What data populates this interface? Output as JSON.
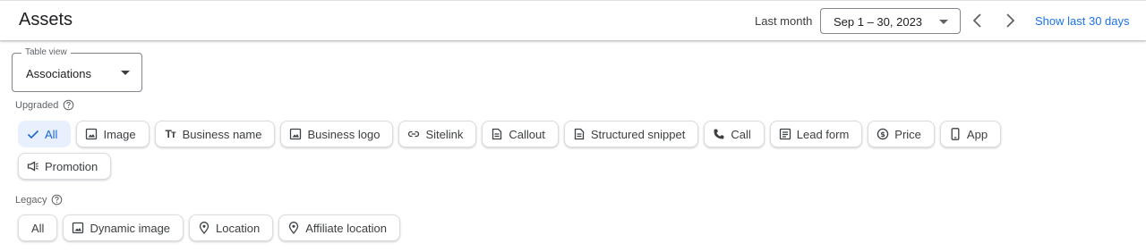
{
  "header": {
    "title": "Assets",
    "range_label": "Last month",
    "date_range": "Sep 1 – 30, 2023",
    "show_last": "Show last 30 days"
  },
  "table_view": {
    "legend": "Table view",
    "value": "Associations"
  },
  "upgraded": {
    "label": "Upgraded",
    "chips": [
      {
        "label": "All",
        "icon": "check-icon",
        "selected": true
      },
      {
        "label": "Image",
        "icon": "image-icon"
      },
      {
        "label": "Business name",
        "icon": "text-icon"
      },
      {
        "label": "Business logo",
        "icon": "image-icon"
      },
      {
        "label": "Sitelink",
        "icon": "link-icon"
      },
      {
        "label": "Callout",
        "icon": "document-icon"
      },
      {
        "label": "Structured snippet",
        "icon": "document-icon"
      },
      {
        "label": "Call",
        "icon": "phone-icon"
      },
      {
        "label": "Lead form",
        "icon": "form-icon"
      },
      {
        "label": "Price",
        "icon": "price-icon"
      },
      {
        "label": "App",
        "icon": "mobile-icon"
      },
      {
        "label": "Promotion",
        "icon": "megaphone-icon"
      }
    ]
  },
  "legacy": {
    "label": "Legacy",
    "chips": [
      {
        "label": "All"
      },
      {
        "label": "Dynamic image",
        "icon": "image-icon"
      },
      {
        "label": "Location",
        "icon": "pin-icon"
      },
      {
        "label": "Affiliate location",
        "icon": "pin-icon"
      }
    ]
  },
  "colors": {
    "accent": "#1a73e8",
    "selected_chip_bg": "#e8f0fe",
    "selected_chip_text": "#1967d2"
  }
}
